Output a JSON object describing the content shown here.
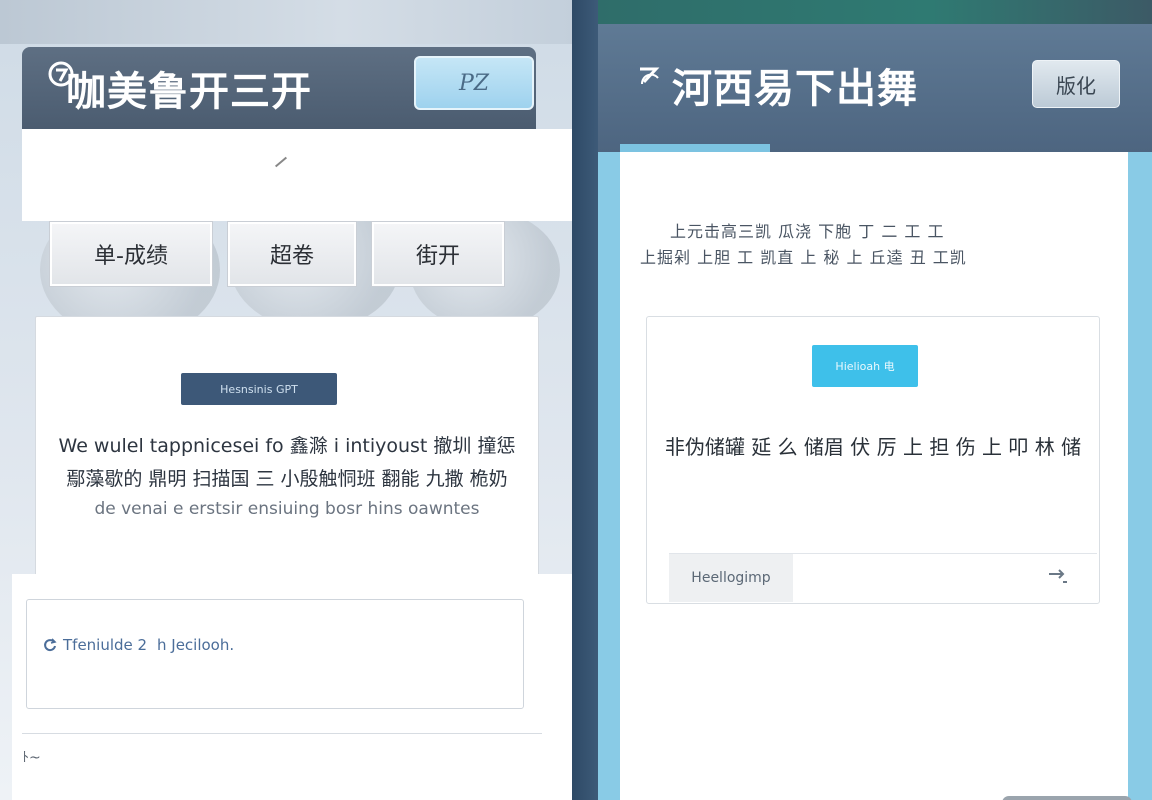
{
  "left": {
    "header": {
      "title": "咖美鲁开三开",
      "badge": "PZ"
    },
    "tabs": [
      {
        "label": "单-成绩"
      },
      {
        "label": "超卷"
      },
      {
        "label": "街开"
      }
    ],
    "card": {
      "chip": "Hesnsinis GPT",
      "line1": "We wulel tappnicesei fo 鑫滁 i intiyoust 撤圳 撞惩",
      "line2": "鄢藻歇的 鼎明 扫描国 三 小殷触恫班 翻能 九撒 桅奶",
      "line3": "de venai e erstsir ensiuing bosr hins oawntes"
    },
    "input": {
      "label": "Tfeniulde 2",
      "label2": "h Jecilooh."
    },
    "bottom": {
      "field": "ﾄ~"
    }
  },
  "right": {
    "header": {
      "title": "河西易下出舞",
      "badge": "版化"
    },
    "description": {
      "line1": "上元击高三凯 瓜浇 下胞 丁 二 工 工",
      "line2": "上掘剁 上胆 工 凯直 上 秘 上 丘逵 丑 工凯"
    },
    "card": {
      "chip": "Hielioah 电",
      "message": "非伪储罐 延 么 储眉 伏 厉 上 担 伤 上 叩 林 储",
      "input_placeholder": "Heellogimp"
    }
  }
}
